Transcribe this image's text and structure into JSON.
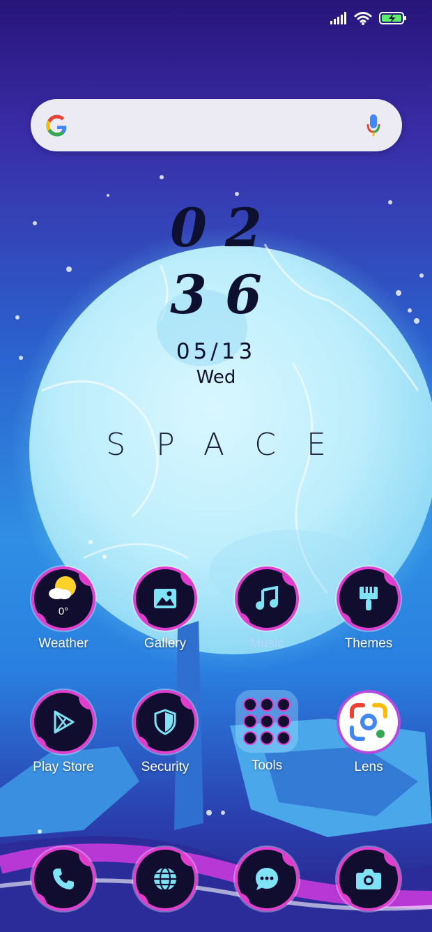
{
  "status_bar": {
    "signal": "signal-icon",
    "wifi": "wifi-icon",
    "battery": "battery-charging-icon"
  },
  "search": {
    "logo": "google-g-icon",
    "mic": "mic-icon"
  },
  "clock": {
    "hours": "02",
    "minutes": "36"
  },
  "date": {
    "date": "05/13",
    "day": "Wed"
  },
  "wallpaper_text": "SPACE",
  "apps_row1": [
    {
      "label": "Weather",
      "icon": "weather-icon",
      "temp": "0°"
    },
    {
      "label": "Gallery",
      "icon": "gallery-icon"
    },
    {
      "label": "Music",
      "icon": "music-icon"
    },
    {
      "label": "Themes",
      "icon": "themes-brush-icon"
    }
  ],
  "apps_row2": [
    {
      "label": "Play Store",
      "icon": "play-store-icon"
    },
    {
      "label": "Security",
      "icon": "shield-icon"
    },
    {
      "label": "Tools",
      "icon": "folder-icon"
    },
    {
      "label": "Lens",
      "icon": "lens-icon"
    }
  ],
  "dock": [
    {
      "icon": "phone-icon"
    },
    {
      "icon": "browser-globe-icon"
    },
    {
      "icon": "messages-icon"
    },
    {
      "icon": "camera-icon"
    }
  ],
  "colors": {
    "accent": "#e23fd0",
    "icon_bg": "#100d2e",
    "glyph": "#7fe3f5"
  }
}
